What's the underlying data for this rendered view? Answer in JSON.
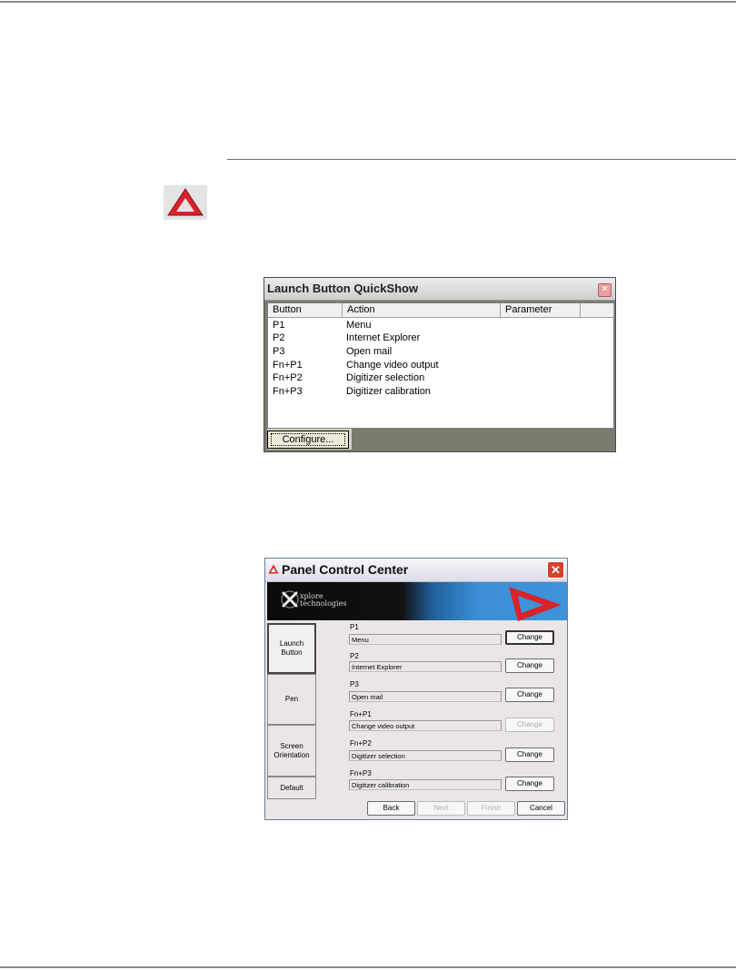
{
  "quickshow": {
    "title": "Launch Button QuickShow",
    "close_glyph": "×",
    "columns": [
      "Button",
      "Action",
      "Parameter"
    ],
    "rows": [
      {
        "button": "P1",
        "action": "Menu"
      },
      {
        "button": "P2",
        "action": "Internet Explorer"
      },
      {
        "button": "P3",
        "action": "Open mail"
      },
      {
        "button": "Fn+P1",
        "action": "Change video output"
      },
      {
        "button": "Fn+P2",
        "action": "Digitizer selection"
      },
      {
        "button": "Fn+P3",
        "action": "Digitizer calibration"
      }
    ],
    "configure_label": "Configure..."
  },
  "panel": {
    "title": "Panel Control Center",
    "close_glyph": "✕",
    "logo_text_line1": "xplore",
    "logo_text_line2": "technologies",
    "tabs": [
      "Launch\nButton",
      "Pen",
      "Screen\nOrientation",
      "Default"
    ],
    "settings": [
      {
        "label": "P1",
        "value": "Menu",
        "button": "Change"
      },
      {
        "label": "P2",
        "value": "Internet Explorer",
        "button": "Change"
      },
      {
        "label": "P3",
        "value": "Open mail",
        "button": "Change"
      },
      {
        "label": "Fn+P1",
        "value": "Change video output",
        "button": "Change"
      },
      {
        "label": "Fn+P2",
        "value": "Digitizer selection",
        "button": "Change"
      },
      {
        "label": "Fn+P3",
        "value": "Digitizer calibration",
        "button": "Change"
      }
    ],
    "nav": {
      "back": "Back",
      "next": "Next",
      "finish": "Finish",
      "cancel": "Cancel"
    }
  },
  "colors": {
    "brand_red": "#d8232a",
    "banner_blue": "#3a8fd6"
  }
}
